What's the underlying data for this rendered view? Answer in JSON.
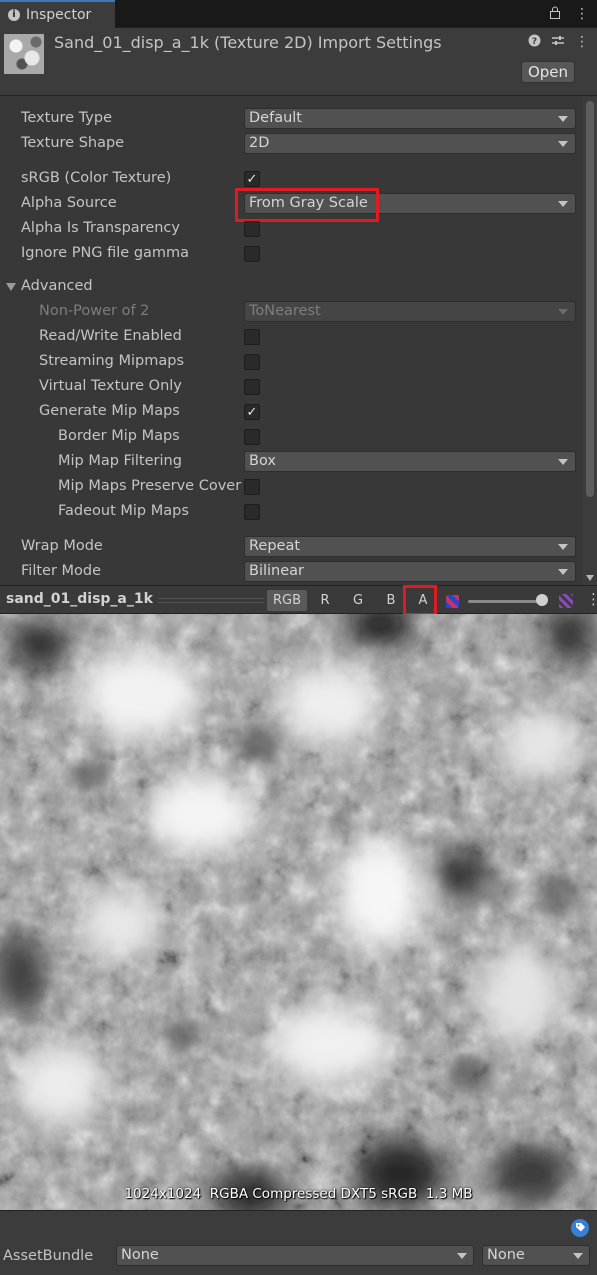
{
  "tab": {
    "title": "Inspector"
  },
  "header": {
    "title": "Sand_01_disp_a_1k (Texture 2D) Import Settings",
    "open_label": "Open"
  },
  "settings": {
    "texture_type": {
      "label": "Texture Type",
      "value": "Default"
    },
    "texture_shape": {
      "label": "Texture Shape",
      "value": "2D"
    },
    "srgb": {
      "label": "sRGB (Color Texture)",
      "checked": true
    },
    "alpha_source": {
      "label": "Alpha Source",
      "value": "From Gray Scale"
    },
    "alpha_is_transparency": {
      "label": "Alpha Is Transparency",
      "checked": false
    },
    "ignore_png_gamma": {
      "label": "Ignore PNG file gamma",
      "checked": false
    },
    "advanced": {
      "label": "Advanced",
      "expanded": true
    },
    "non_power_of_2": {
      "label": "Non-Power of 2",
      "value": "ToNearest"
    },
    "read_write": {
      "label": "Read/Write Enabled",
      "checked": false
    },
    "streaming_mipmaps": {
      "label": "Streaming Mipmaps",
      "checked": false
    },
    "virtual_texture_only": {
      "label": "Virtual Texture Only",
      "checked": false
    },
    "generate_mip_maps": {
      "label": "Generate Mip Maps",
      "checked": true
    },
    "border_mip_maps": {
      "label": "Border Mip Maps",
      "checked": false
    },
    "mip_map_filtering": {
      "label": "Mip Map Filtering",
      "value": "Box"
    },
    "mip_maps_preserve_coverage": {
      "label": "Mip Maps Preserve Coverage",
      "checked": false
    },
    "fadeout_mip_maps": {
      "label": "Fadeout Mip Maps",
      "checked": false
    },
    "wrap_mode": {
      "label": "Wrap Mode",
      "value": "Repeat"
    },
    "filter_mode": {
      "label": "Filter Mode",
      "value": "Bilinear"
    }
  },
  "preview": {
    "name": "sand_01_disp_a_1k",
    "channels": {
      "rgb": "RGB",
      "r": "R",
      "g": "G",
      "b": "B",
      "a": "A"
    },
    "selected_channel": "A",
    "info": "1024x1024  RGBA Compressed DXT5 sRGB  1.3 MB"
  },
  "asset_bundle": {
    "label": "AssetBundle",
    "name": "None",
    "variant": "None"
  },
  "colors": {
    "highlight": "#e21a22",
    "tab_accent": "#3a79bb",
    "tag_icon": "#3a7fd6"
  }
}
